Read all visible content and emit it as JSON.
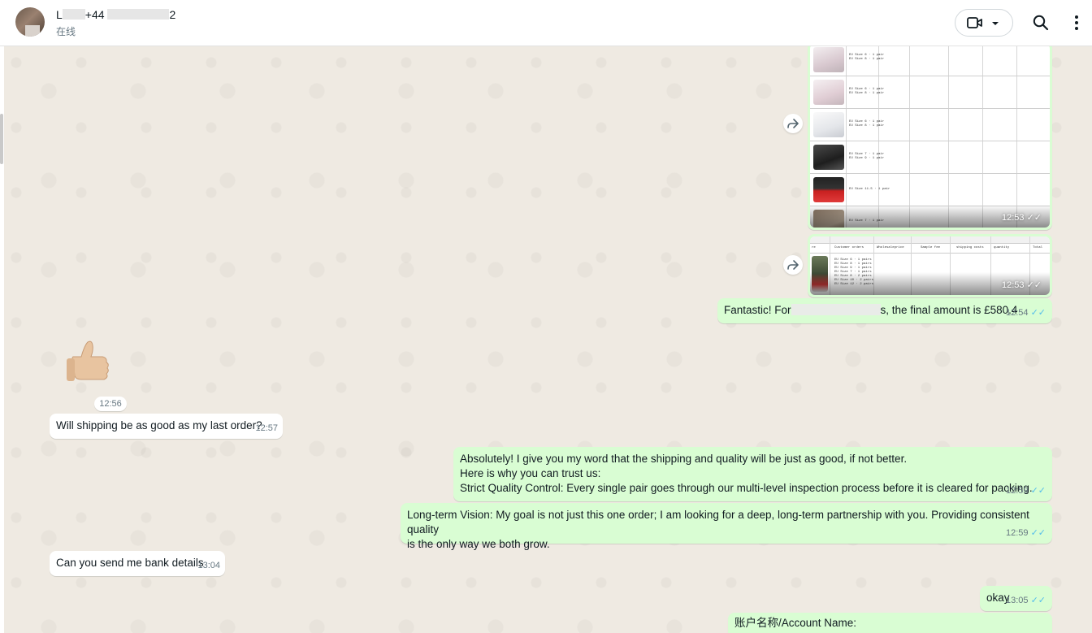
{
  "header": {
    "contact_name_start": "L",
    "contact_name_mid": "+44",
    "contact_name_end": "2",
    "status": "在线"
  },
  "images": [
    {
      "time": "12:53",
      "ticks": "✓✓"
    },
    {
      "time": "12:53",
      "ticks": "✓✓",
      "sheet_headers": [
        "re",
        "Customer orders",
        "Wholesaleprice",
        "Sample fee",
        "shipping costs",
        "quantity",
        "Total"
      ]
    }
  ],
  "messages": [
    {
      "dir": "out",
      "text_before": "Fantastic! For",
      "text_after": "s, the final amount is £580.4",
      "time": "12:54",
      "ticks": "✓✓"
    },
    {
      "dir": "in",
      "sticker": "thumbs-up",
      "time": "12:56"
    },
    {
      "dir": "in",
      "text": "Will shipping be as good as my last order?",
      "time": "12:57"
    },
    {
      "dir": "out",
      "lines": [
        "Absolutely! I give you my word that the shipping and quality will be just as good, if not better.",
        "Here is why you can trust us:",
        "Strict Quality Control: Every single pair goes through our multi-level inspection process before it is cleared for packing."
      ],
      "time": "12:59",
      "ticks": "✓✓"
    },
    {
      "dir": "out",
      "lines": [
        "Long-term Vision: My goal is not just this one order; I am looking for a deep, long-term partnership with you. Providing consistent quality",
        "is the only way we both grow."
      ],
      "time": "12:59",
      "ticks": "✓✓"
    },
    {
      "dir": "in",
      "text": "Can you send me bank details",
      "time": "13:04"
    },
    {
      "dir": "out",
      "text": "okay",
      "time": "13:05",
      "ticks": "✓✓"
    },
    {
      "dir": "out",
      "text": "账户名称/Account Name:"
    }
  ],
  "colors": {
    "outgoing": "#d9fdd3",
    "incoming": "#ffffff",
    "read_ticks": "#53bdeb",
    "wallpaper": "#efeae2"
  },
  "icons": [
    "video-call-icon",
    "chevron-down-icon",
    "search-icon",
    "more-options-icon",
    "forward-icon",
    "thumbs-up-sticker"
  ]
}
